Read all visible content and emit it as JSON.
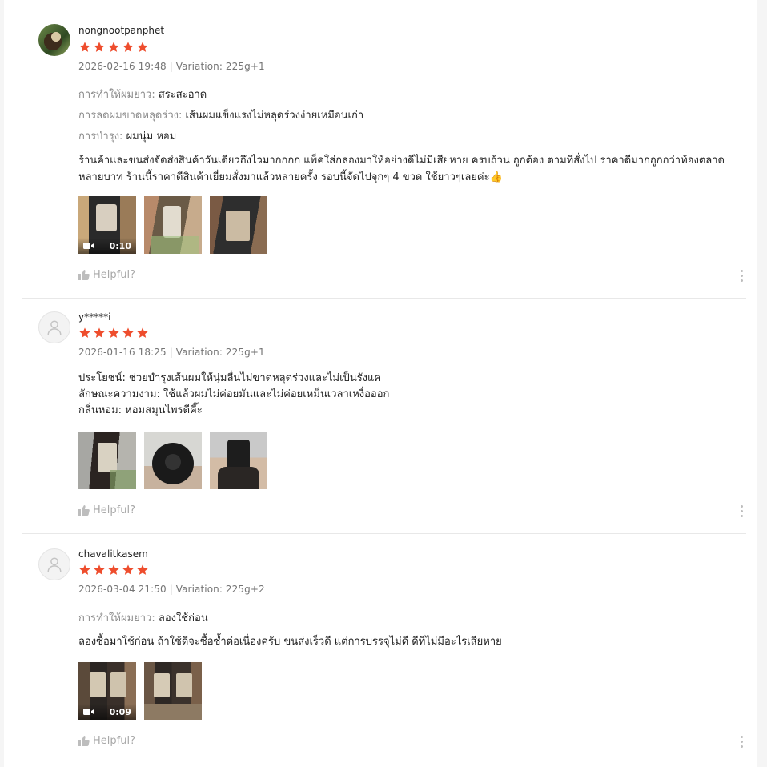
{
  "colors": {
    "star": "#ee4d2d",
    "text": "#222222",
    "muted": "#757575"
  },
  "reviews": [
    {
      "username": "nongnootpanphet",
      "rating": 5,
      "meta": "2026-02-16 19:48 | Variation: 225g+1",
      "attributes": [
        {
          "label": "การทำให้ผมยาว:",
          "value": "สระสะอาด"
        },
        {
          "label": "การลดผมขาดหลุดร่วง:",
          "value": "เส้นผมแข็งแรงไม่หลุดร่วงง่ายเหมือนเก่า"
        },
        {
          "label": "การบำรุง:",
          "value": "ผมนุ่ม หอม"
        }
      ],
      "text": "ร้านค้าและขนส่งจัดส่งสินค้าวันเดียวถึงไวมากกกก แพ็คใส่กล่องมาให้อย่างดีไม่มีเสียหาย ครบถ้วน ถูกต้อง ตามที่สั่งไป ราคาดีมากถูกกว่าท้องตลาด หลายบาท ร้านนี้ราคาดีสินค้าเยี่ยมสั่งมาแล้วหลายครั้ง รอบนี้จัดไปจุกๆ 4 ขวด ใช้ยาวๆเลยค่ะ👍",
      "media": [
        {
          "type": "video",
          "duration": "0:10"
        },
        {
          "type": "image"
        },
        {
          "type": "image"
        }
      ],
      "helpful": "Helpful?"
    },
    {
      "username": "y*****i",
      "rating": 5,
      "meta": "2026-01-16 18:25 | Variation: 225g+1",
      "attributes": [],
      "text_lines": [
        "ประโยชน์: ช่วยบำรุงเส้นผมให้นุ่มลื่นไม่ขาดหลุดร่วงและไม่เป็นรังแค",
        "ลักษณะความงาม: ใช้แล้วผมไม่ค่อยมันและไม่ค่อยเหม็นเวลาเหงื่อออก",
        "กลิ่นหอม: หอมสมุนไพรดีคี๊ะ"
      ],
      "media": [
        {
          "type": "image"
        },
        {
          "type": "image"
        },
        {
          "type": "image"
        }
      ],
      "helpful": "Helpful?"
    },
    {
      "username": "chavalitkasem",
      "rating": 5,
      "meta": "2026-03-04 21:50 | Variation: 225g+2",
      "attributes": [
        {
          "label": "การทำให้ผมยาว:",
          "value": "ลองใช้ก่อน"
        }
      ],
      "text": "ลองซื้อมาใช้ก่อน ถ้าใช้ดีจะซื้อซ้ำต่อเนื่องครับ ขนส่งเร็วดี แต่การบรรจุไม่ดี ดีที่ไม่มีอะไรเสียหาย",
      "media": [
        {
          "type": "video",
          "duration": "0:09"
        },
        {
          "type": "image"
        }
      ],
      "helpful": "Helpful?"
    }
  ]
}
